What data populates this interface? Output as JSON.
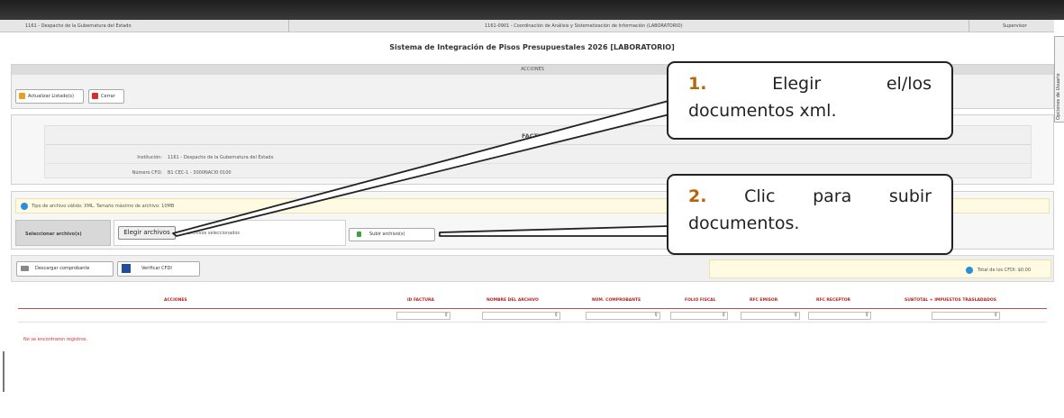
{
  "topbar": {
    "institution": "1161 - Despacho de la Gubernatura del Estado",
    "department": "1161-0901 - Coordinación de Análisis y Sistematización de Información (LABORATORIO)",
    "user": "Supervisor"
  },
  "side_tab": {
    "label": "Opciones de Usuario"
  },
  "page_title": "Sistema de Integración de Pisos Presupuestales 2026 [LABORATORIO]",
  "acciones": {
    "header": "ACCIONES",
    "update_button": "Actualizar Listado(s)",
    "close_button": "Cerrar"
  },
  "facturas": {
    "header": "FACTURAS",
    "institucion_label": "Institución:",
    "institucion_value": "1161 - Despacho de la Gubernatura del Estado",
    "numero_label": "Número CFO:",
    "numero_value": "B1 CEC-1 - 3000NACI0 0100"
  },
  "upload": {
    "info_text": "Tipo de archivo válido: XML. Tamaño máximo de archivo: 10MB",
    "select_label": "Seleccionar archivo(s)",
    "choose_button": "Elegir archivos",
    "no_files_text": "Sin archivos seleccionados",
    "upload_button": "Subir archivo(s)"
  },
  "toolbar": {
    "download_button": "Descargar comprobante",
    "verify_button": "Verificar CFDI",
    "total_text": "Total de los CFDI: $0.00"
  },
  "table": {
    "columns": [
      "ACCIONES",
      "ID FACTURA",
      "NOMBRE DEL ARCHIVO",
      "NÚM. COMPROBANTE",
      "FOLIO FISCAL",
      "RFC EMISOR",
      "RFC RECEPTOR",
      "SUBTOTAL + IMPUESTOS TRASLADADOS"
    ],
    "empty_text": "No se encontraron registros."
  },
  "callouts": {
    "step1_number": "1.",
    "step1_line1": "Elegir el/los",
    "step1_line2": "documentos xml.",
    "step2_number": "2.",
    "step2_line1": "Clic para subir",
    "step2_line2": "documentos."
  },
  "colors": {
    "accent_red": "#b22222",
    "callout_number": "#b8640a",
    "info_blue": "#2a8fd6",
    "warning_bg": "#fffbe3"
  }
}
